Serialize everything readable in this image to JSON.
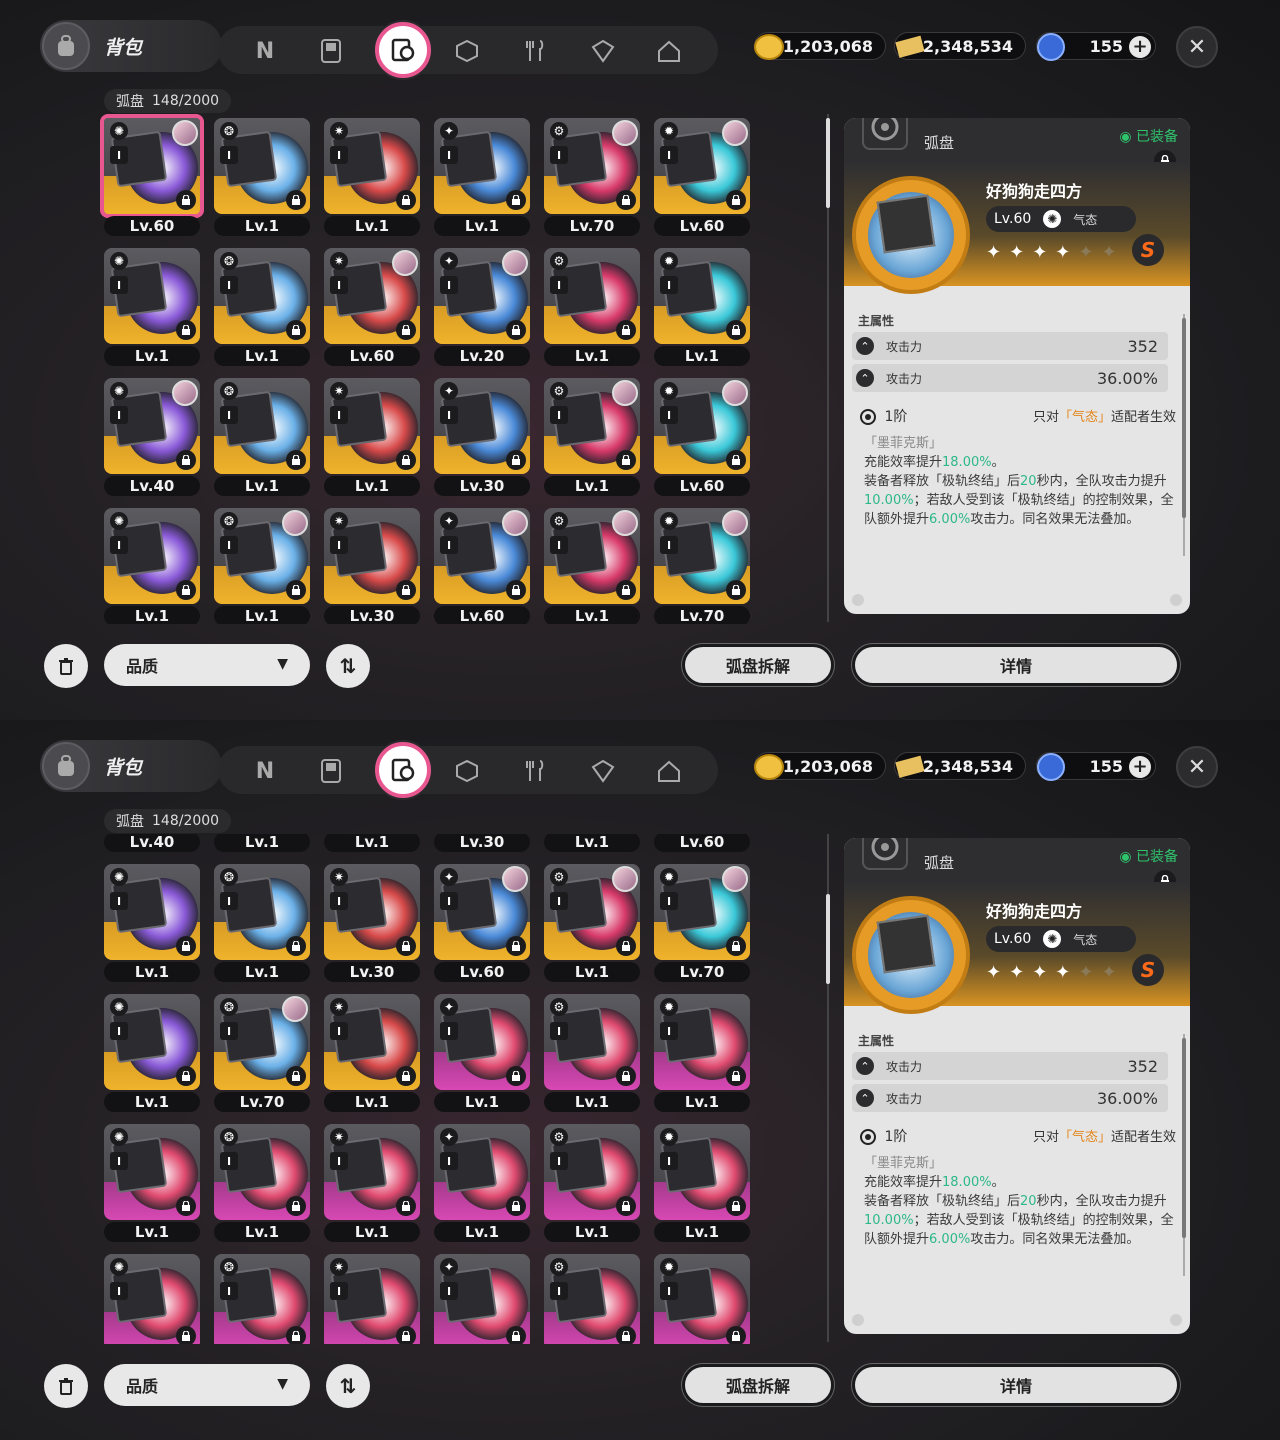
{
  "header": {
    "title": "背包"
  },
  "tabs": [
    "n-tab",
    "console-tab",
    "disc-tab",
    "box-tab",
    "food-tab",
    "module-tab",
    "home-tab"
  ],
  "active_tab_index": 2,
  "currencies": [
    {
      "name": "coin",
      "value": "1,203,068"
    },
    {
      "name": "ticket",
      "value": "2,348,534"
    },
    {
      "name": "energy",
      "value": "155"
    }
  ],
  "grid": {
    "label": "弧盘",
    "count": "148/2000"
  },
  "panel1_levels": [
    "Lv.60",
    "Lv.1",
    "Lv.1",
    "Lv.1",
    "Lv.70",
    "Lv.60",
    "Lv.1",
    "Lv.1",
    "Lv.60",
    "Lv.20",
    "Lv.1",
    "Lv.1",
    "Lv.40",
    "Lv.1",
    "Lv.1",
    "Lv.30",
    "Lv.1",
    "Lv.60",
    "Lv.1",
    "Lv.1",
    "Lv.30",
    "Lv.60",
    "Lv.1",
    "Lv.70"
  ],
  "panel2_levels": [
    "Lv.40",
    "Lv.1",
    "Lv.1",
    "Lv.30",
    "Lv.1",
    "Lv.60",
    "Lv.1",
    "Lv.1",
    "Lv.30",
    "Lv.60",
    "Lv.1",
    "Lv.70",
    "Lv.1",
    "Lv.70",
    "Lv.1",
    "Lv.1",
    "Lv.1",
    "Lv.1",
    "Lv.1",
    "Lv.1",
    "Lv.1",
    "Lv.1",
    "Lv.1",
    "Lv.1",
    "",
    "",
    "",
    "",
    "",
    ""
  ],
  "detail": {
    "category": "弧盘",
    "equipped": "已装备",
    "name": "好狗狗走四方",
    "level": "Lv.60",
    "attribute": "气态",
    "stars_on": 4,
    "stars_total": 6,
    "rank": "S",
    "main_stats_label": "主属性",
    "stats": [
      {
        "name": "攻击力",
        "value": "352"
      },
      {
        "name": "攻击力",
        "value": "36.00%"
      }
    ],
    "tier": "1阶",
    "condition_prefix": "只对",
    "condition_hl": "「气态」",
    "condition_suffix": "适配者生效",
    "effect_name": "「墨菲克斯」",
    "effect_line1_a": "充能效率提升",
    "effect_line1_g": "18.00%",
    "effect_line1_b": "。",
    "effect_line2_a": "装备者释放「极轨终结」后",
    "effect_line2_g": "20",
    "effect_line2_b": "秒内，全队攻击力提升",
    "effect_line2_g2": "10.00%",
    "effect_line2_c": "；若敌人受到该「极轨终结」的控制效果，全队额外提升",
    "effect_line2_g3": "6.00%",
    "effect_line2_d": "攻击力。同名效果无法叠加。"
  },
  "bottom": {
    "quality": "品质",
    "dismantle": "弧盘拆解",
    "details": "详情"
  },
  "colors": {
    "accent": "#e8578f",
    "gold": "#f0b32c",
    "green": "#2fc36c",
    "orange": "#e3861c"
  }
}
